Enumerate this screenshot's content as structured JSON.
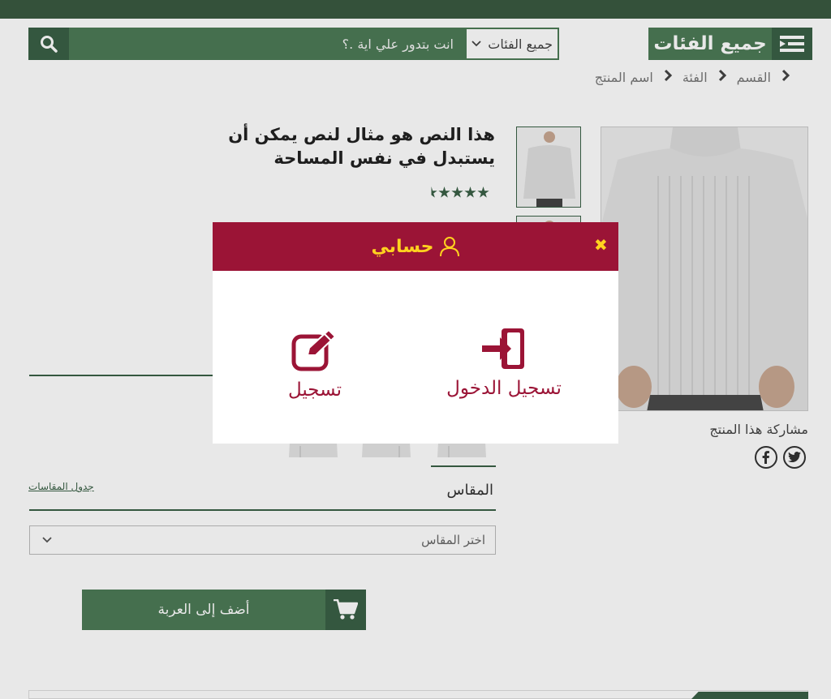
{
  "header": {
    "categories_button": "جميع الفئات",
    "search": {
      "placeholder": "انت بتدور علي اية .؟",
      "category_select": "جميع الفئات"
    }
  },
  "breadcrumb": [
    "القسم",
    "الفئة",
    "اسم المنتج"
  ],
  "product": {
    "title": "هذا النص هو مثال لنص يمكن أن يستبدل في نفس المساحة",
    "rating": 4.5
  },
  "share": {
    "label": "مشاركة هذا المنتج",
    "icons": [
      "facebook-icon",
      "twitter-icon"
    ]
  },
  "size": {
    "label": "المقاس",
    "chart_link": "جدول المقاسات",
    "select_placeholder": "اختر المقاس"
  },
  "cart": {
    "add_label": "أضف إلى العربة"
  },
  "modal": {
    "title": "حسابي",
    "close": "✖",
    "login_label": "تسجيل الدخول",
    "register_label": "تسجيل"
  },
  "colors": {
    "primary_dark": "#3a6046",
    "primary": "#4c7a56",
    "modal_header": "#9b1436",
    "modal_accent": "#ffd21f"
  }
}
